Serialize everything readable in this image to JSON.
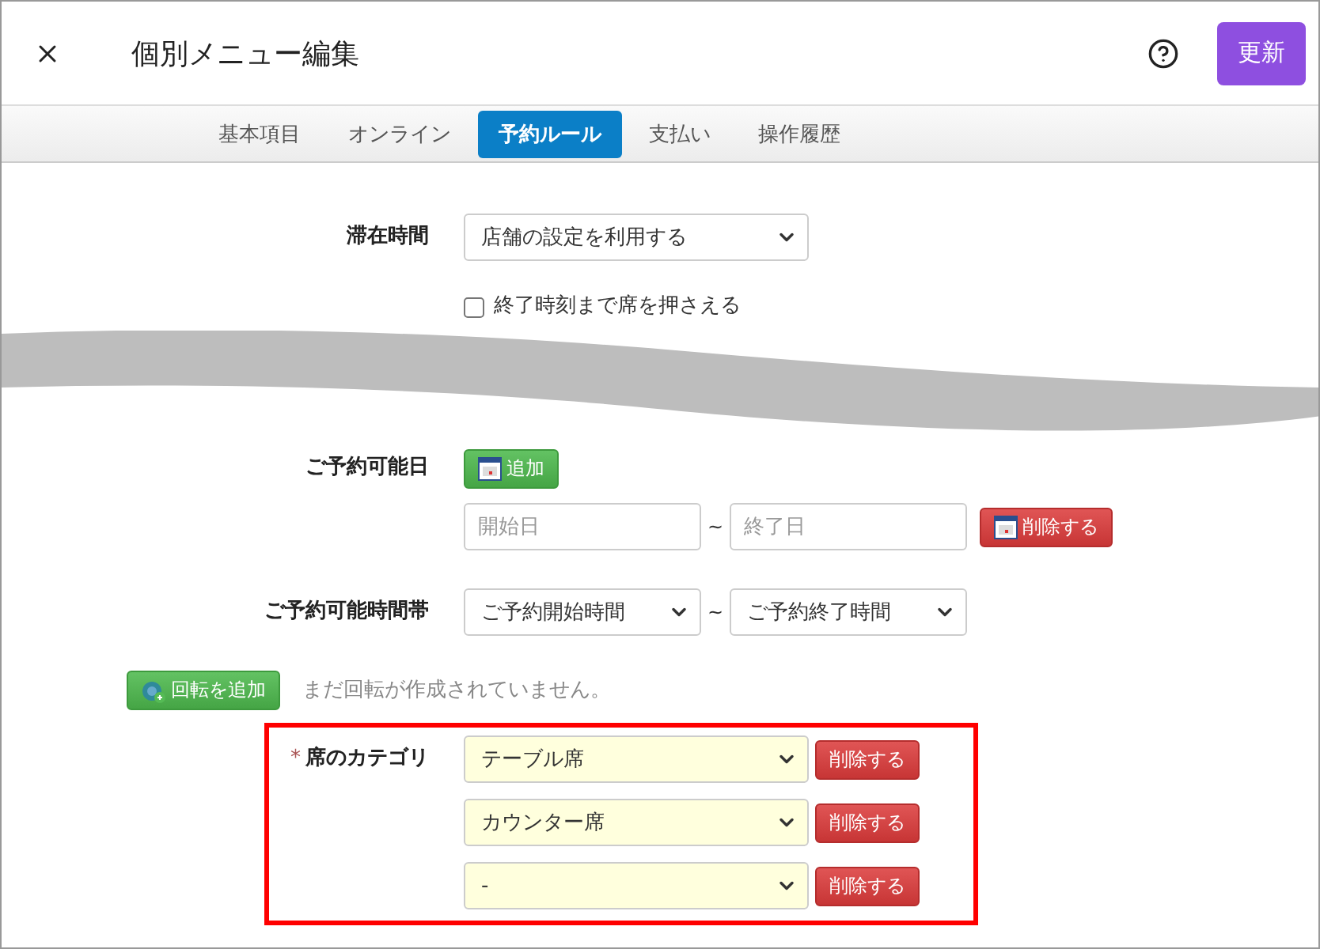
{
  "header": {
    "title": "個別メニュー編集",
    "update_button": "更新"
  },
  "tabs": [
    {
      "label": "基本項目",
      "selected": false
    },
    {
      "label": "オンライン",
      "selected": false
    },
    {
      "label": "予約ルール",
      "selected": true
    },
    {
      "label": "支払い",
      "selected": false
    },
    {
      "label": "操作履歴",
      "selected": false
    }
  ],
  "stay_time": {
    "label": "滞在時間",
    "value": "店舗の設定を利用する"
  },
  "hold_seat": {
    "label": "終了時刻まで席を押さえる",
    "checked": false
  },
  "available_dates": {
    "label": "ご予約可能日",
    "add_button": "追加",
    "start_placeholder": "開始日",
    "separator": "~",
    "end_placeholder": "終了日",
    "delete_button": "削除する"
  },
  "time_range": {
    "label": "ご予約可能時間帯",
    "start_value": "ご予約開始時間",
    "separator": "~",
    "end_value": "ご予約終了時間"
  },
  "rotation": {
    "add_button": "回転を追加",
    "message": "まだ回転が作成されていません。"
  },
  "seat_category": {
    "required_mark": "*",
    "label": "席のカテゴリ",
    "highlighted": true,
    "rows": [
      {
        "value": "テーブル席",
        "delete_button": "削除する"
      },
      {
        "value": "カウンター席",
        "delete_button": "削除する"
      },
      {
        "value": "-",
        "delete_button": "削除する"
      }
    ]
  }
}
